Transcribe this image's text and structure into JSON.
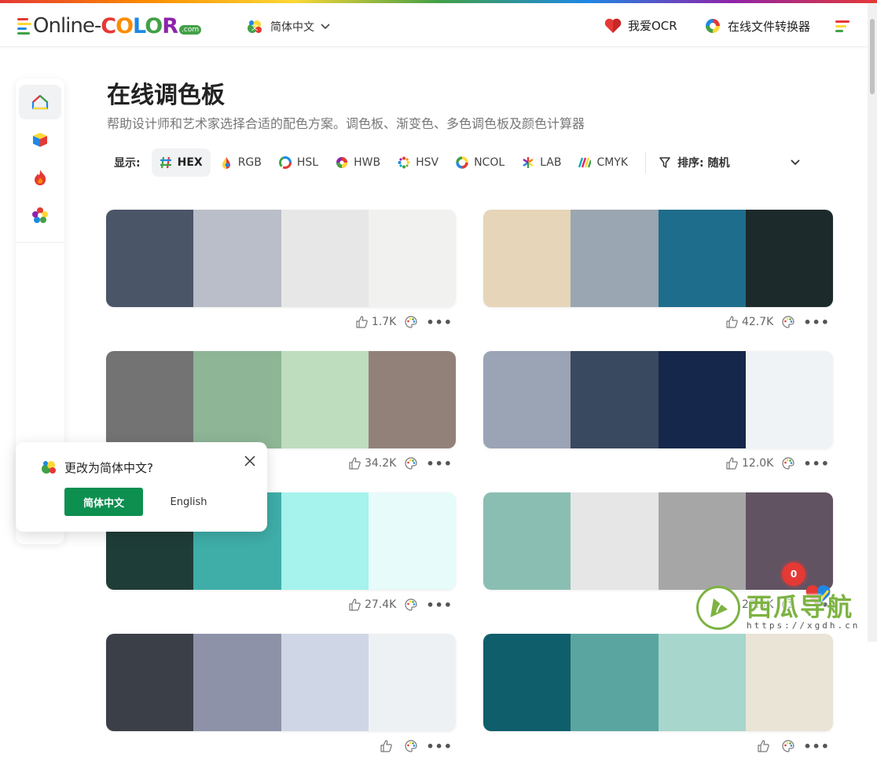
{
  "header": {
    "logo_online": "Online-",
    "logo_color": [
      "C",
      "O",
      "L",
      "O",
      "R"
    ],
    "logo_color_hex": [
      "#e53935",
      "#fb8c00",
      "#1e88e5",
      "#43a047",
      "#8e24aa"
    ],
    "logo_com": ".com",
    "language": "简体中文",
    "links": [
      {
        "label": "我爱OCR",
        "icon": "heart-icon"
      },
      {
        "label": "在线文件转换器",
        "icon": "converter-icon"
      }
    ]
  },
  "sidebar": {
    "items": [
      {
        "icon": "home-icon",
        "active": true
      },
      {
        "icon": "cube-icon",
        "active": false
      },
      {
        "icon": "fire-icon",
        "active": false
      },
      {
        "icon": "star-icon",
        "active": false
      }
    ]
  },
  "main": {
    "title": "在线调色板",
    "subtitle": "帮助设计师和艺术家选择合适的配色方案。调色板、渐变色、多色调色板及颜色计算器"
  },
  "toolbar": {
    "display_label": "显示:",
    "formats": [
      {
        "label": "HEX",
        "icon": "hash-icon",
        "active": true
      },
      {
        "label": "RGB",
        "icon": "rgb-drop-icon",
        "active": false
      },
      {
        "label": "HSL",
        "icon": "hsl-icon",
        "active": false
      },
      {
        "label": "HWB",
        "icon": "hwb-icon",
        "active": false
      },
      {
        "label": "HSV",
        "icon": "hsv-icon",
        "active": false
      },
      {
        "label": "NCOL",
        "icon": "ncol-icon",
        "active": false
      },
      {
        "label": "LAB",
        "icon": "lab-icon",
        "active": false
      },
      {
        "label": "CMYK",
        "icon": "cmyk-icon",
        "active": false
      }
    ],
    "sort_label": "排序: 随机"
  },
  "palettes": [
    {
      "colors": [
        "#4a5568",
        "#b9bec8",
        "#e7e7e7",
        "#f1f1f0"
      ],
      "likes": "1.7K"
    },
    {
      "colors": [
        "#e6d5b8",
        "#9aa6b1",
        "#1f6d8c",
        "#1c2a2b"
      ],
      "likes": "42.7K"
    },
    {
      "colors": [
        "#737373",
        "#8db596",
        "#bedcbe",
        "#928178"
      ],
      "likes": "34.2K"
    },
    {
      "colors": [
        "#9aa4b5",
        "#39495f",
        "#15284c",
        "#f0f3f5"
      ],
      "likes": "12.0K"
    },
    {
      "colors": [
        "#1f3d38",
        "#3fada8",
        "#a6f2ec",
        "#e6fbfa"
      ],
      "likes": "27.4K"
    },
    {
      "colors": [
        "#8bbeb2",
        "#e6e6e6",
        "#a6a6a6",
        "#625363"
      ],
      "likes": "27.5K"
    },
    {
      "colors": [
        "#3b3f47",
        "#8e92a8",
        "#cfd7e6",
        "#eef1f4"
      ],
      "likes": ""
    },
    {
      "colors": [
        "#0f5e6b",
        "#5aa5a0",
        "#a7d6cc",
        "#e9e4d6"
      ],
      "likes": ""
    }
  ],
  "lang_popup": {
    "question": "更改为简体中文?",
    "confirm": "简体中文",
    "alternative": "English"
  },
  "watermark": {
    "badge": "0",
    "title": "西瓜导航",
    "url": "https://xgdh.cn"
  }
}
